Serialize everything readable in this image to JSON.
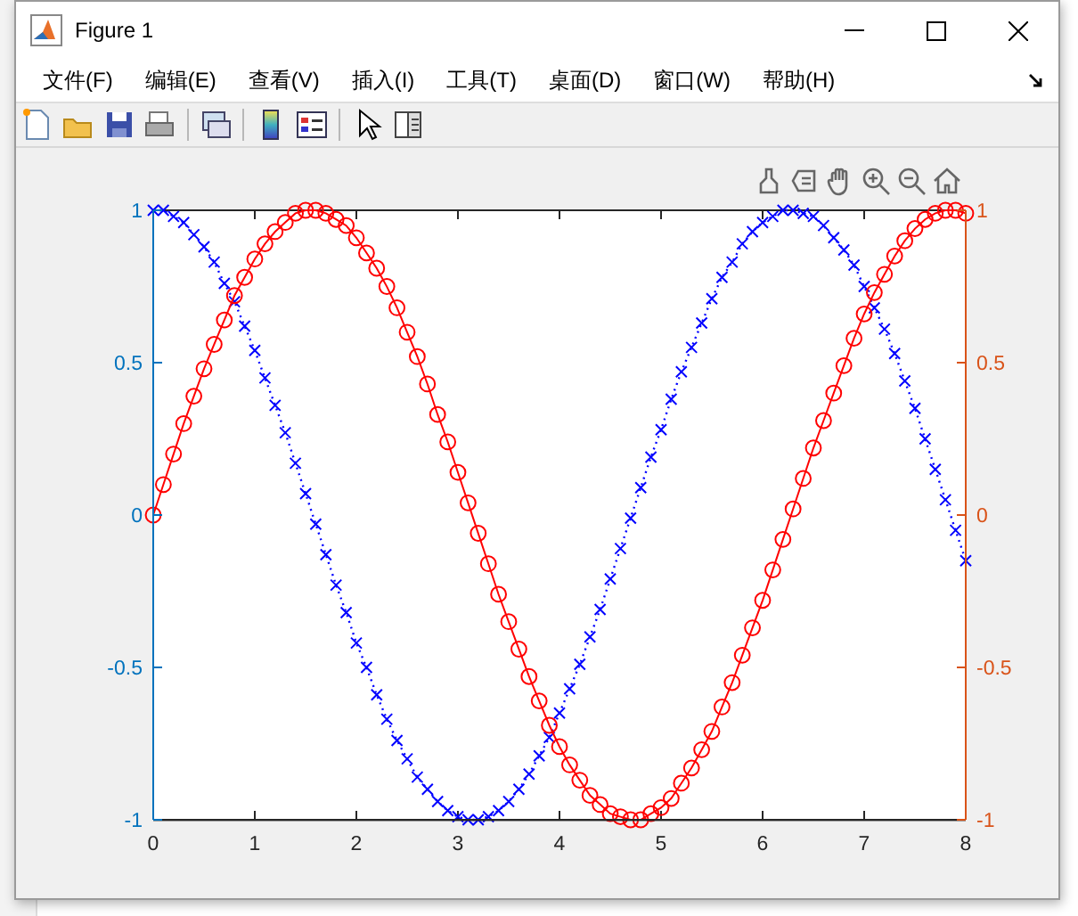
{
  "window": {
    "title": "Figure 1"
  },
  "menu": [
    "文件(F)",
    "编辑(E)",
    "查看(V)",
    "插入(I)",
    "工具(T)",
    "桌面(D)",
    "窗口(W)",
    "帮助(H)"
  ],
  "chart_data": {
    "type": "line",
    "x": [
      0,
      0.1,
      0.2,
      0.3,
      0.4,
      0.5,
      0.6,
      0.7,
      0.8,
      0.9,
      1,
      1.1,
      1.2,
      1.3,
      1.4,
      1.5,
      1.6,
      1.7,
      1.8,
      1.9,
      2,
      2.1,
      2.2,
      2.3,
      2.4,
      2.5,
      2.6,
      2.7,
      2.8,
      2.9,
      3,
      3.1,
      3.2,
      3.3,
      3.4,
      3.5,
      3.6,
      3.7,
      3.8,
      3.9,
      4,
      4.1,
      4.2,
      4.3,
      4.4,
      4.5,
      4.6,
      4.7,
      4.8,
      4.9,
      5,
      5.1,
      5.2,
      5.3,
      5.4,
      5.5,
      5.6,
      5.7,
      5.8,
      5.9,
      6,
      6.1,
      6.2,
      6.3,
      6.4,
      6.5,
      6.6,
      6.7,
      6.8,
      6.9,
      7,
      7.1,
      7.2,
      7.3,
      7.4,
      7.5,
      7.6,
      7.7,
      7.8,
      7.9,
      8
    ],
    "series": [
      {
        "color": "#0000ff",
        "marker": "x",
        "line_style": "dotted",
        "values": [
          1,
          1,
          0.98,
          0.96,
          0.92,
          0.88,
          0.83,
          0.76,
          0.7,
          0.62,
          0.54,
          0.45,
          0.36,
          0.27,
          0.17,
          0.07,
          -0.03,
          -0.13,
          -0.23,
          -0.32,
          -0.42,
          -0.5,
          -0.59,
          -0.67,
          -0.74,
          -0.8,
          -0.86,
          -0.9,
          -0.94,
          -0.97,
          -0.99,
          -1,
          -1,
          -0.99,
          -0.97,
          -0.94,
          -0.9,
          -0.85,
          -0.79,
          -0.73,
          -0.65,
          -0.57,
          -0.49,
          -0.4,
          -0.31,
          -0.21,
          -0.11,
          -0.01,
          0.09,
          0.19,
          0.28,
          0.38,
          0.47,
          0.55,
          0.63,
          0.71,
          0.78,
          0.83,
          0.89,
          0.93,
          0.96,
          0.98,
          1,
          1,
          0.99,
          0.98,
          0.95,
          0.91,
          0.87,
          0.82,
          0.75,
          0.68,
          0.61,
          0.53,
          0.44,
          0.35,
          0.25,
          0.15,
          0.05,
          -0.05,
          -0.15
        ]
      },
      {
        "color": "#ff0000",
        "marker": "o",
        "line_style": "solid",
        "values": [
          0,
          0.1,
          0.2,
          0.3,
          0.39,
          0.48,
          0.56,
          0.64,
          0.72,
          0.78,
          0.84,
          0.89,
          0.93,
          0.96,
          0.99,
          1,
          1,
          0.99,
          0.97,
          0.95,
          0.91,
          0.86,
          0.81,
          0.75,
          0.68,
          0.6,
          0.52,
          0.43,
          0.33,
          0.24,
          0.14,
          0.04,
          -0.06,
          -0.16,
          -0.26,
          -0.35,
          -0.44,
          -0.53,
          -0.61,
          -0.69,
          -0.76,
          -0.82,
          -0.87,
          -0.92,
          -0.95,
          -0.98,
          -0.99,
          -1,
          -1,
          -0.98,
          -0.96,
          -0.93,
          -0.88,
          -0.83,
          -0.77,
          -0.71,
          -0.63,
          -0.55,
          -0.46,
          -0.37,
          -0.28,
          -0.18,
          -0.08,
          0.02,
          0.12,
          0.22,
          0.31,
          0.4,
          0.49,
          0.58,
          0.66,
          0.73,
          0.79,
          0.85,
          0.9,
          0.94,
          0.97,
          0.99,
          1,
          1,
          0.99
        ]
      }
    ],
    "xlim": [
      0,
      8
    ],
    "ylim": [
      -1,
      1
    ],
    "xticks": [
      0,
      1,
      2,
      3,
      4,
      5,
      6,
      7,
      8
    ],
    "yticks": [
      -1,
      -0.5,
      0,
      0.5,
      1
    ],
    "y2lim": [
      -1,
      1
    ],
    "y2ticks": [
      -1,
      -0.5,
      0,
      0.5,
      1
    ]
  }
}
